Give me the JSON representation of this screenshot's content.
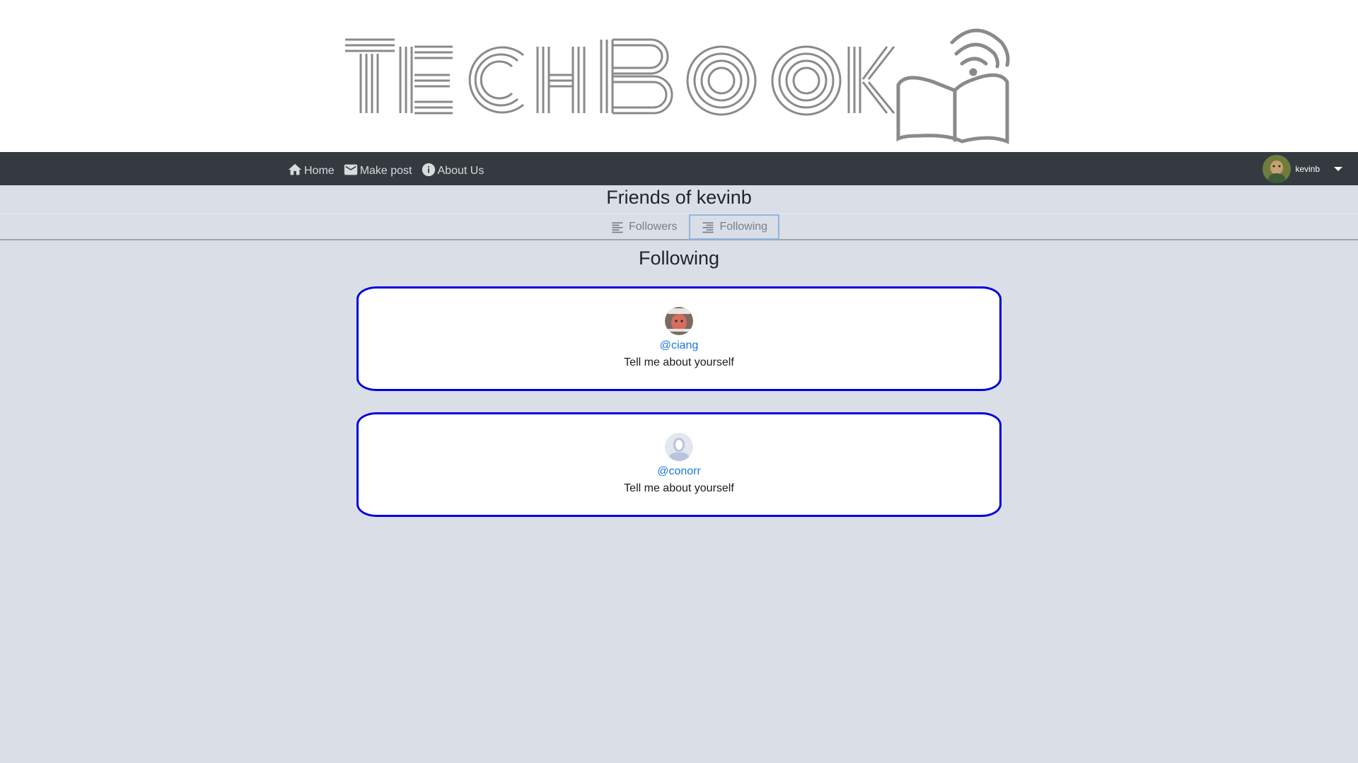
{
  "brand": {
    "logo_text": "TECHBOOK"
  },
  "nav": {
    "items": [
      {
        "label": "Home",
        "icon": "home-icon"
      },
      {
        "label": "Make post",
        "icon": "mail-icon"
      },
      {
        "label": "About Us",
        "icon": "info-icon"
      }
    ],
    "user": {
      "name": "kevinb"
    }
  },
  "page": {
    "title": "Friends of kevinb",
    "tabs": [
      {
        "label": "Followers",
        "icon": "align-left-icon",
        "active": false
      },
      {
        "label": "Following",
        "icon": "align-right-icon",
        "active": true
      }
    ],
    "section_heading": "Following"
  },
  "following": [
    {
      "handle": "@ciang",
      "bio": "Tell me about yourself",
      "avatar": "photo"
    },
    {
      "handle": "@conorr",
      "bio": "Tell me about yourself",
      "avatar": "placeholder"
    }
  ],
  "colors": {
    "navbar": "#343a40",
    "page_bg": "#dadfe7",
    "card_border": "#0000dd",
    "link": "#1f74e0",
    "logo_gray": "#8a8a8a"
  }
}
